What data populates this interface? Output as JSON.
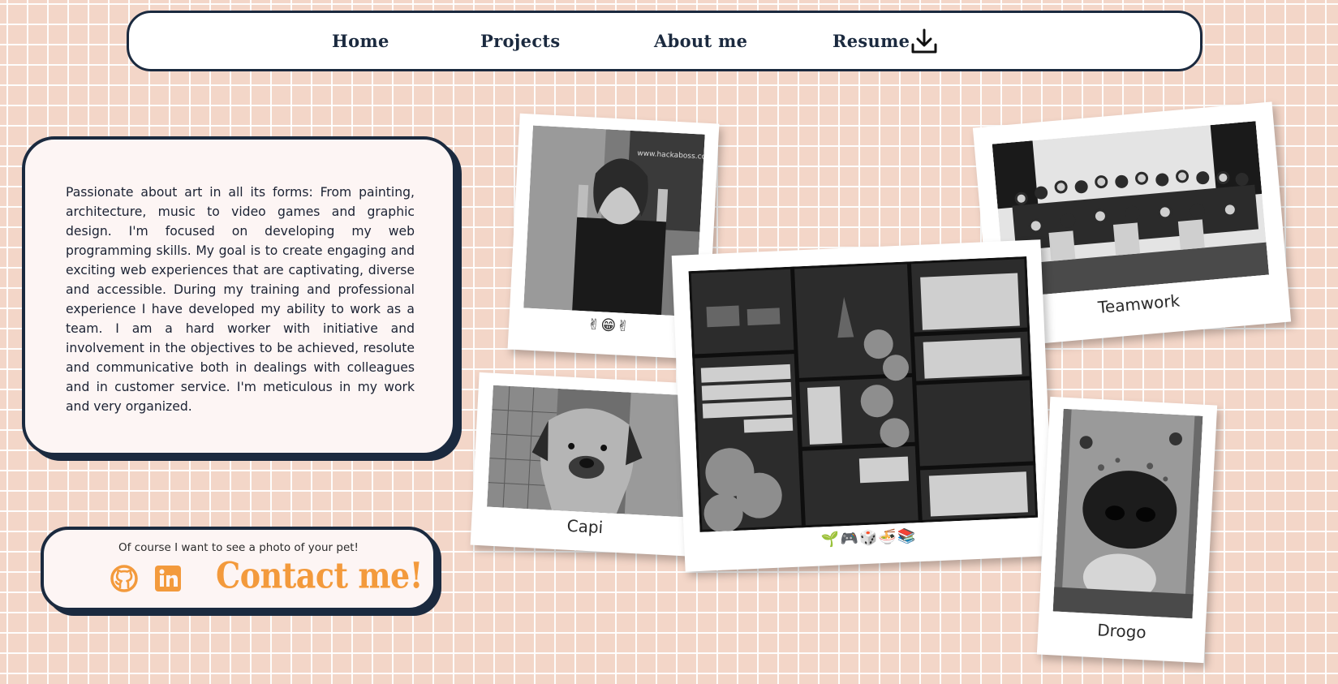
{
  "nav": {
    "items": [
      {
        "label": "Home"
      },
      {
        "label": "Projects"
      },
      {
        "label": "About me"
      },
      {
        "label": "Resume"
      }
    ],
    "resume_icon": "download-icon"
  },
  "bio": {
    "text": "Passionate about art in all its forms: From painting, architecture, music to video games and graphic design. I'm focused on developing my web programming skills. My goal is to create engaging and exciting web experiences that are captivating, diverse and accessible. During my training and professional experience I have developed my ability to work as a team. I am a hard worker with initiative and involvement in the objectives to be achieved, resolute and communicative both in dealings with colleagues and in customer service. I'm meticulous in my work and very organized."
  },
  "contact": {
    "note": "Of course I want to see a photo of your pet!",
    "link_label": "Contact me!",
    "icons": [
      "github-icon",
      "linkedin-icon"
    ],
    "accent_color": "#f39a3c"
  },
  "photos": {
    "portrait": {
      "caption": "✌😁✌"
    },
    "teamwork": {
      "caption": "Teamwork"
    },
    "shelf": {
      "caption": "🌱🎮🎲🍜📚"
    },
    "capi": {
      "caption": "Capi"
    },
    "drogo": {
      "caption": "Drogo"
    }
  },
  "colors": {
    "background": "#f3d6c8",
    "navy": "#1b2a3f",
    "card": "#fdf5f4"
  }
}
